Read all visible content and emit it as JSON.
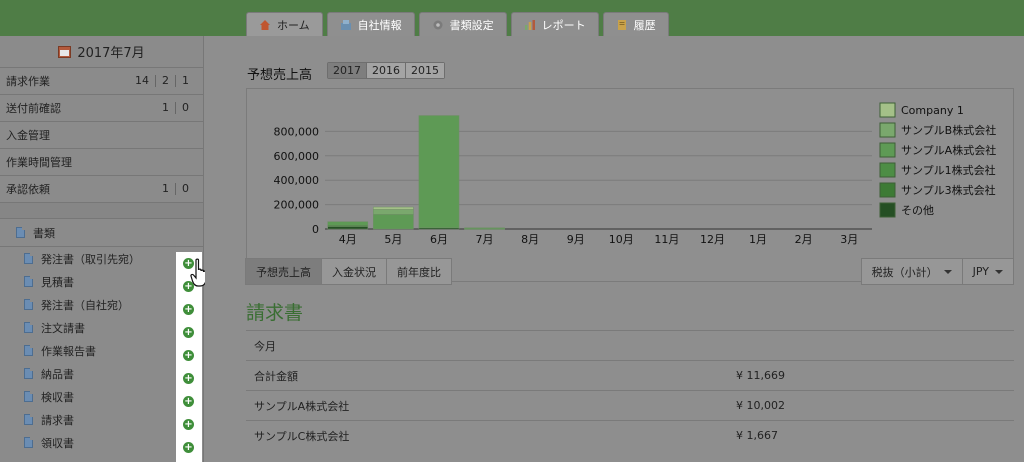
{
  "tabs": [
    {
      "label": "ホーム",
      "icon": "home-icon"
    },
    {
      "label": "自社情報",
      "icon": "building-icon"
    },
    {
      "label": "書類設定",
      "icon": "gear-icon"
    },
    {
      "label": "レポート",
      "icon": "bar-chart-icon"
    },
    {
      "label": "履歴",
      "icon": "document-icon"
    }
  ],
  "sidebar": {
    "month": "2017年7月",
    "menu": [
      {
        "label": "請求作業",
        "counts": [
          "14",
          "2",
          "1"
        ]
      },
      {
        "label": "送付前確認",
        "counts": [
          "1",
          "0"
        ]
      },
      {
        "label": "入金管理",
        "counts": []
      },
      {
        "label": "作業時間管理",
        "counts": []
      },
      {
        "label": "承認依頼",
        "counts": [
          "1",
          "0"
        ]
      }
    ],
    "docs_section": "書類",
    "docs": [
      "発注書（取引先宛）",
      "見積書",
      "発注書（自社宛）",
      "注文請書",
      "作業報告書",
      "納品書",
      "検収書",
      "請求書",
      "領収書"
    ]
  },
  "main": {
    "forecast_title": "予想売上高",
    "years": [
      "2017",
      "2016",
      "2015"
    ],
    "subtabs": [
      "予想売上高",
      "入金状況",
      "前年度比"
    ],
    "tax_dropdown": "税抜（小計）",
    "currency_dropdown": "JPY",
    "invoice_title": "請求書",
    "invoice_rows": [
      {
        "label": "今月",
        "value": ""
      },
      {
        "label": "合計金額",
        "value": "¥ 11,669"
      },
      {
        "label": "サンプルA株式会社",
        "value": "¥ 10,002"
      },
      {
        "label": "サンプルC株式会社",
        "value": "¥ 1,667"
      }
    ]
  },
  "chart_data": {
    "type": "bar",
    "stacked": true,
    "categories": [
      "4月",
      "5月",
      "6月",
      "7月",
      "8月",
      "9月",
      "10月",
      "11月",
      "12月",
      "1月",
      "2月",
      "3月"
    ],
    "y_ticks": [
      "0",
      "200,000",
      "400,000",
      "600,000",
      "800,000"
    ],
    "ylim": [
      0,
      1000000
    ],
    "legend_position": "right",
    "grid": true,
    "series": [
      {
        "name": "その他",
        "color": "#254f24",
        "values": [
          20000,
          0,
          10000,
          0,
          0,
          0,
          0,
          0,
          0,
          0,
          0,
          0
        ]
      },
      {
        "name": "サンプル3株式会社",
        "color": "#3d7a35",
        "values": [
          10000,
          0,
          0,
          0,
          0,
          0,
          0,
          0,
          0,
          0,
          0,
          0
        ]
      },
      {
        "name": "サンプル1株式会社",
        "color": "#4d8d45",
        "values": [
          0,
          0,
          0,
          5000,
          0,
          0,
          0,
          0,
          0,
          0,
          0,
          0
        ]
      },
      {
        "name": "サンプルA株式会社",
        "color": "#5e9a55",
        "values": [
          30000,
          120000,
          920000,
          5000,
          0,
          0,
          0,
          0,
          0,
          0,
          0,
          0
        ]
      },
      {
        "name": "サンプルB株式会社",
        "color": "#7aa86d",
        "values": [
          0,
          40000,
          0,
          0,
          0,
          0,
          0,
          0,
          0,
          0,
          0,
          0
        ]
      },
      {
        "name": "Company 1",
        "color": "#a4c088",
        "values": [
          0,
          20000,
          0,
          0,
          0,
          0,
          0,
          0,
          0,
          0,
          0,
          0
        ]
      }
    ]
  }
}
